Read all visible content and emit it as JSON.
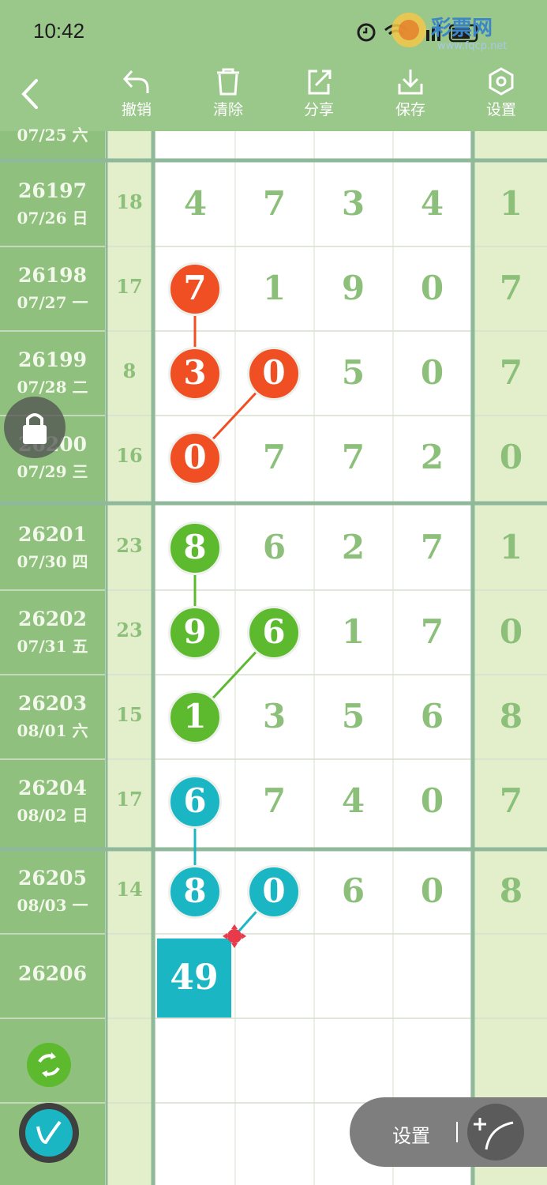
{
  "status": {
    "time": "10:42"
  },
  "watermark": {
    "text": "彩票网",
    "url": "www.fqcp.net"
  },
  "toolbar": {
    "back": "back",
    "undo": "撤销",
    "clear": "清除",
    "share": "分享",
    "save": "保存",
    "settings": "设置"
  },
  "partial_row": {
    "date": "07/25 六"
  },
  "rows": [
    {
      "issue": "26197",
      "date": "07/26 日",
      "sum": "18",
      "d": [
        "4",
        "7",
        "3",
        "4"
      ],
      "r": "1"
    },
    {
      "issue": "26198",
      "date": "07/27 一",
      "sum": "17",
      "d": [
        "7",
        "1",
        "9",
        "0"
      ],
      "r": "7"
    },
    {
      "issue": "26199",
      "date": "07/28 二",
      "sum": "8",
      "d": [
        "3",
        "0",
        "5",
        "0"
      ],
      "r": "7"
    },
    {
      "issue": "26200",
      "date": "07/29 三",
      "sum": "16",
      "d": [
        "0",
        "7",
        "7",
        "2"
      ],
      "r": "0"
    },
    {
      "issue": "26201",
      "date": "07/30 四",
      "sum": "23",
      "d": [
        "8",
        "6",
        "2",
        "7"
      ],
      "r": "1"
    },
    {
      "issue": "26202",
      "date": "07/31 五",
      "sum": "23",
      "d": [
        "9",
        "6",
        "1",
        "7"
      ],
      "r": "0"
    },
    {
      "issue": "26203",
      "date": "08/01 六",
      "sum": "15",
      "d": [
        "1",
        "3",
        "5",
        "6"
      ],
      "r": "8"
    },
    {
      "issue": "26204",
      "date": "08/02 日",
      "sum": "17",
      "d": [
        "6",
        "7",
        "4",
        "0"
      ],
      "r": "7"
    },
    {
      "issue": "26205",
      "date": "08/03 一",
      "sum": "14",
      "d": [
        "8",
        "0",
        "6",
        "0"
      ],
      "r": "8"
    },
    {
      "issue": "26206",
      "date": "",
      "sum": "",
      "d": [
        "",
        "",
        "",
        ""
      ],
      "r": ""
    }
  ],
  "prediction": "49",
  "markers": [
    {
      "row": 1,
      "col": 0,
      "color": "#ef4f22"
    },
    {
      "row": 2,
      "col": 0,
      "color": "#ef4f22"
    },
    {
      "row": 2,
      "col": 1,
      "color": "#ef4f22"
    },
    {
      "row": 3,
      "col": 0,
      "color": "#ef4f22"
    },
    {
      "row": 4,
      "col": 0,
      "color": "#5dba2e"
    },
    {
      "row": 5,
      "col": 0,
      "color": "#5dba2e"
    },
    {
      "row": 5,
      "col": 1,
      "color": "#5dba2e"
    },
    {
      "row": 6,
      "col": 0,
      "color": "#5dba2e"
    },
    {
      "row": 7,
      "col": 0,
      "color": "#1ab6c4"
    },
    {
      "row": 8,
      "col": 0,
      "color": "#1ab6c4"
    },
    {
      "row": 8,
      "col": 1,
      "color": "#1ab6c4"
    }
  ],
  "colors": {
    "header_green": "#9ac78a",
    "left_green": "#8fc07e",
    "light_green": "#e3efcb",
    "digit_green": "#8cc07a",
    "red": "#ef4f22",
    "green": "#5dba2e",
    "cyan": "#1ab6c4"
  },
  "bottom": {
    "settings_label": "设置"
  }
}
